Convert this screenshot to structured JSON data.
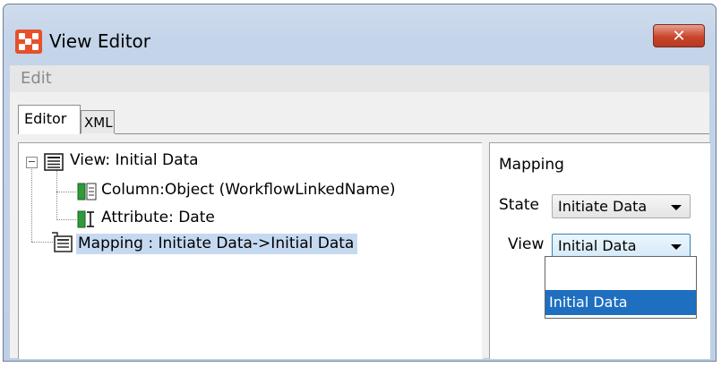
{
  "window": {
    "title": "View Editor",
    "close_glyph": "✕"
  },
  "menubar": {
    "items": [
      {
        "label": "Edit"
      }
    ]
  },
  "tabs": [
    {
      "label": "Editor"
    },
    {
      "label": "XML"
    }
  ],
  "tree": {
    "root": "View: Initial Data",
    "children": [
      {
        "label": "Column:Object (WorkflowLinkedName)",
        "icon": "column-icon"
      },
      {
        "label": "Attribute: Date",
        "icon": "attribute-icon"
      }
    ],
    "mapping": "Mapping : Initiate Data->Initial Data"
  },
  "mapping_panel": {
    "heading": "Mapping",
    "state_label": "State",
    "state_value": "Initiate Data",
    "view_label": "View",
    "view_value": "Initial Data",
    "view_options": [
      "",
      "Initial Data"
    ]
  },
  "colors": {
    "selection": "#c5d9f1",
    "dropdown_highlight": "#1e6fbf",
    "close_button": "#c9452b",
    "app_icon": "#e6502a"
  }
}
